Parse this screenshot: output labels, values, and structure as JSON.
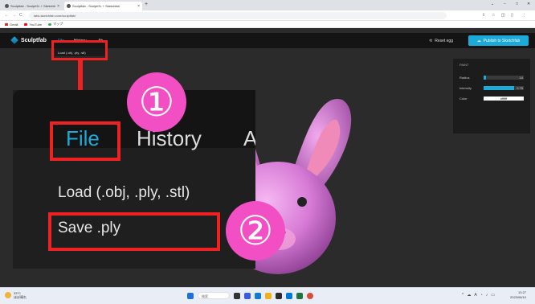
{
  "browser": {
    "tabs": [
      {
        "title": "Sculptfab - SculptGL + Sketchfab",
        "active": false
      },
      {
        "title": "Sculptfab - SculptGL + Sketchfab",
        "active": true
      }
    ],
    "new_tab": "+",
    "window_controls": [
      "⌄",
      "−",
      "□",
      "✕"
    ],
    "nav": {
      "back": "←",
      "forward": "→",
      "reload": "C"
    },
    "url": "labs.sketchfab.com/sculptfab/",
    "bookmarks": [
      "Gmail",
      "YouTube",
      "マップ"
    ]
  },
  "app": {
    "brand": "Sculptfab",
    "menu": {
      "file": "File",
      "history": "History",
      "about_partial": "Ab"
    },
    "dropdown_small": {
      "load": "Load (.obj, .ply, .stl)"
    },
    "reset": "Reset egg",
    "publish": "Publish to Sketchfab",
    "panel": {
      "title": "PAINT",
      "radius_label": "Radius",
      "radius_value": "14",
      "radius_fraction": 0.05,
      "intensity_label": "Intensity",
      "intensity_value": "0.75",
      "intensity_fraction": 0.75,
      "color_label": "Color",
      "color_value": "#ffffff"
    }
  },
  "zoom": {
    "file": "File",
    "history": "History",
    "about_partial": "A",
    "load": "Load (.obj, .ply, .stl)",
    "save": "Save .ply"
  },
  "annotations": {
    "step1": "①",
    "step2": "②",
    "accent": "#ee2222",
    "marker": "#f24fc4"
  },
  "taskbar": {
    "weather_temp": "33°C",
    "weather_desc": "ほぼ晴れ",
    "search": "検索",
    "time": "13:27",
    "date": "2023/08/10"
  }
}
